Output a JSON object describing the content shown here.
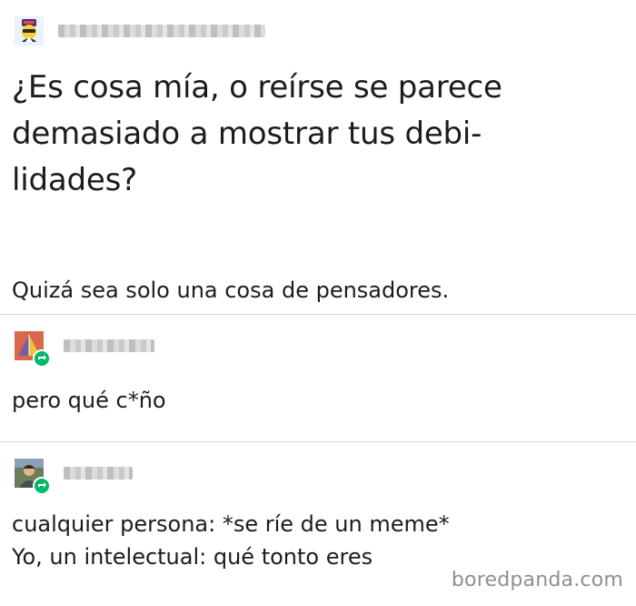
{
  "posts": [
    {
      "username_obscured": "",
      "avatar_icon": "yellow-cartoon-character-avatar-icon",
      "title_lines": [
        "¿Es cosa mía, o reírse se parece",
        "demasiado a mostrar tus debi-",
        "lidades?"
      ],
      "subtitle": "Quizá sea solo una cosa de pensadores."
    },
    {
      "username_obscured": "",
      "avatar_icon": "pyramid-avatar-icon",
      "reblog_icon": "reblog-icon",
      "text": "pero qué c*ño"
    },
    {
      "username_obscured": "",
      "avatar_icon": "person-photo-avatar-icon",
      "reblog_icon": "reblog-icon",
      "lines": [
        "cualquier persona: *se ríe de un meme*",
        "Yo, un intelectual: qué tonto eres"
      ]
    }
  ],
  "watermark": "boredpanda.com",
  "colors": {
    "text": "#1c1c1c",
    "divider": "#d6d6d6",
    "reblog_badge": "#00b86b",
    "watermark": "#8f8f8f"
  }
}
